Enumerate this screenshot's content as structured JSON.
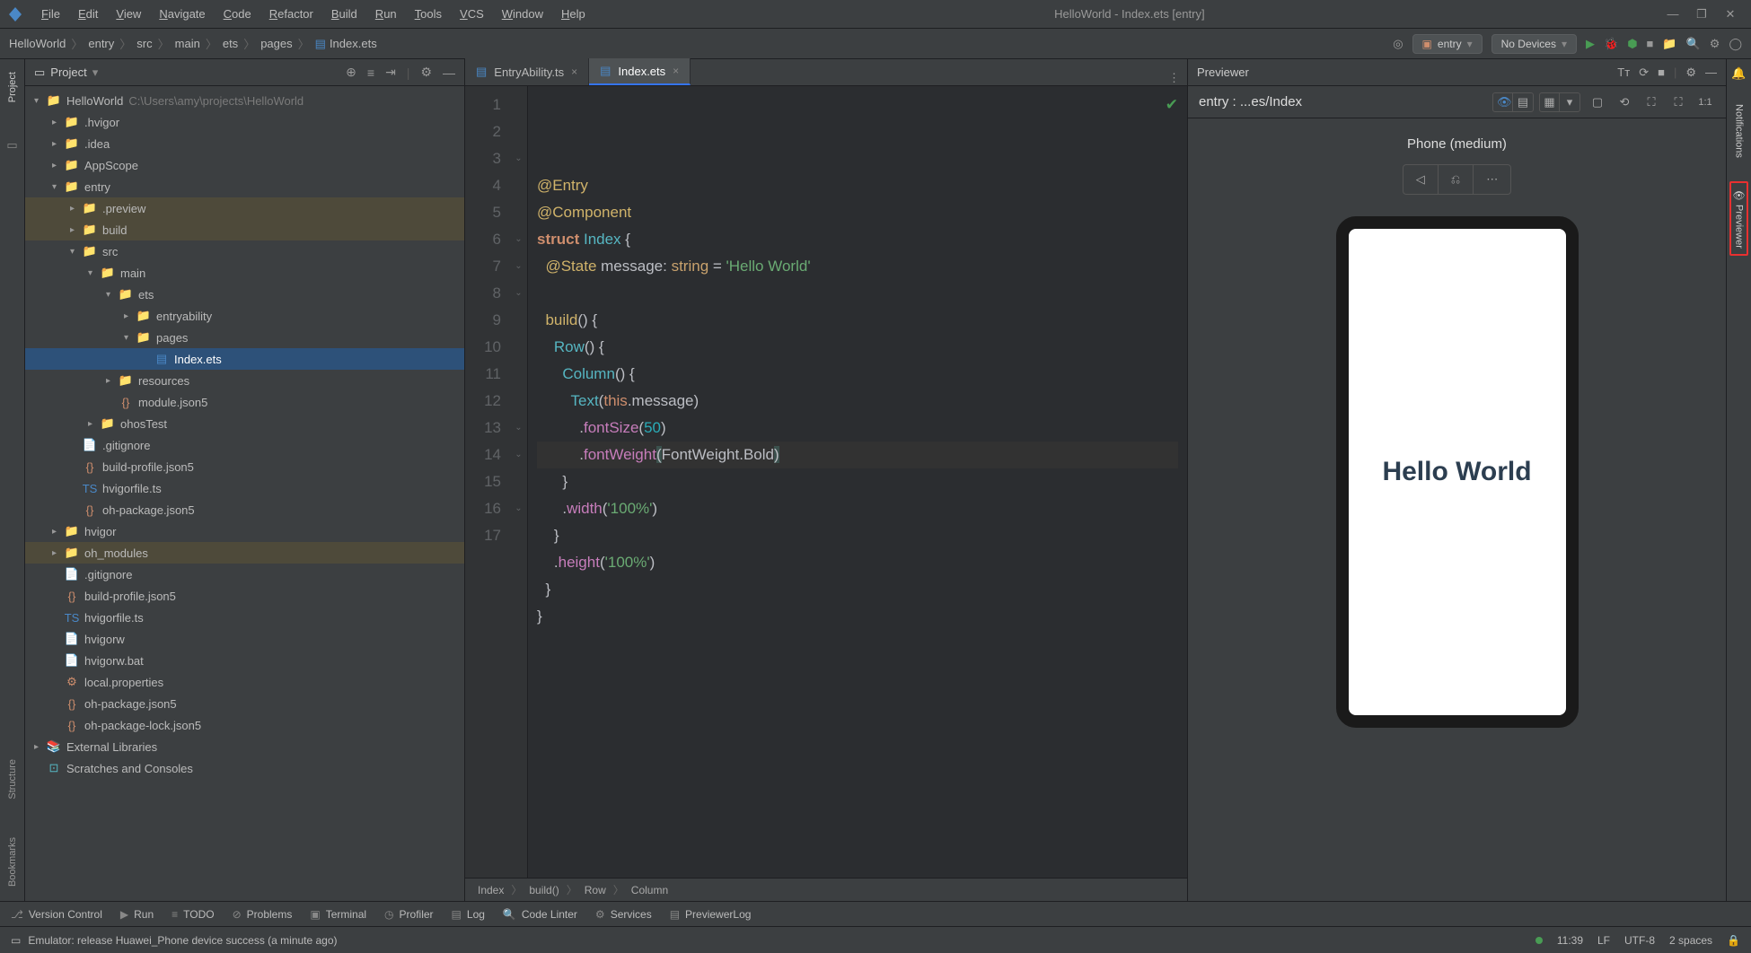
{
  "window_title": "HelloWorld - Index.ets [entry]",
  "menus": [
    "File",
    "Edit",
    "View",
    "Navigate",
    "Code",
    "Refactor",
    "Build",
    "Run",
    "Tools",
    "VCS",
    "Window",
    "Help"
  ],
  "breadcrumb": {
    "items": [
      "HelloWorld",
      "entry",
      "src",
      "main",
      "ets",
      "pages",
      "Index.ets"
    ]
  },
  "run_config": {
    "module": "entry",
    "device": "No Devices"
  },
  "project": {
    "panel_label": "Project",
    "root": {
      "name": "HelloWorld",
      "path": "C:\\Users\\amy\\projects\\HelloWorld"
    },
    "tree": [
      {
        "depth": 0,
        "arrow": "v",
        "icon": "folder-teal",
        "label": "HelloWorld",
        "extra": "C:\\Users\\amy\\projects\\HelloWorld"
      },
      {
        "depth": 1,
        "arrow": ">",
        "icon": "folder-gray",
        "label": ".hvigor"
      },
      {
        "depth": 1,
        "arrow": ">",
        "icon": "folder-gray",
        "label": ".idea"
      },
      {
        "depth": 1,
        "arrow": ">",
        "icon": "folder-gray",
        "label": "AppScope"
      },
      {
        "depth": 1,
        "arrow": "v",
        "icon": "folder-teal",
        "label": "entry"
      },
      {
        "depth": 2,
        "arrow": ">",
        "icon": "folder-orange",
        "label": ".preview",
        "hl": true
      },
      {
        "depth": 2,
        "arrow": ">",
        "icon": "folder-orange",
        "label": "build",
        "hl": true
      },
      {
        "depth": 2,
        "arrow": "v",
        "icon": "folder-gray",
        "label": "src"
      },
      {
        "depth": 3,
        "arrow": "v",
        "icon": "folder-gray",
        "label": "main"
      },
      {
        "depth": 4,
        "arrow": "v",
        "icon": "folder-gray",
        "label": "ets"
      },
      {
        "depth": 5,
        "arrow": ">",
        "icon": "folder-gray",
        "label": "entryability"
      },
      {
        "depth": 5,
        "arrow": "v",
        "icon": "folder-gray",
        "label": "pages"
      },
      {
        "depth": 6,
        "arrow": "",
        "icon": "file-ets",
        "label": "Index.ets",
        "sel": true
      },
      {
        "depth": 4,
        "arrow": ">",
        "icon": "folder-gray",
        "label": "resources"
      },
      {
        "depth": 4,
        "arrow": "",
        "icon": "file-json",
        "label": "module.json5"
      },
      {
        "depth": 3,
        "arrow": ">",
        "icon": "folder-gray",
        "label": "ohosTest"
      },
      {
        "depth": 2,
        "arrow": "",
        "icon": "file",
        "label": ".gitignore"
      },
      {
        "depth": 2,
        "arrow": "",
        "icon": "file-json",
        "label": "build-profile.json5"
      },
      {
        "depth": 2,
        "arrow": "",
        "icon": "file-ts",
        "label": "hvigorfile.ts"
      },
      {
        "depth": 2,
        "arrow": "",
        "icon": "file-json",
        "label": "oh-package.json5"
      },
      {
        "depth": 1,
        "arrow": ">",
        "icon": "folder-gray",
        "label": "hvigor"
      },
      {
        "depth": 1,
        "arrow": ">",
        "icon": "folder-orange",
        "label": "oh_modules",
        "hl": true
      },
      {
        "depth": 1,
        "arrow": "",
        "icon": "file",
        "label": ".gitignore"
      },
      {
        "depth": 1,
        "arrow": "",
        "icon": "file-json",
        "label": "build-profile.json5"
      },
      {
        "depth": 1,
        "arrow": "",
        "icon": "file-ts",
        "label": "hvigorfile.ts"
      },
      {
        "depth": 1,
        "arrow": "",
        "icon": "file",
        "label": "hvigorw"
      },
      {
        "depth": 1,
        "arrow": "",
        "icon": "file",
        "label": "hvigorw.bat"
      },
      {
        "depth": 1,
        "arrow": "",
        "icon": "file-prop",
        "label": "local.properties"
      },
      {
        "depth": 1,
        "arrow": "",
        "icon": "file-json",
        "label": "oh-package.json5"
      },
      {
        "depth": 1,
        "arrow": "",
        "icon": "file-json",
        "label": "oh-package-lock.json5"
      },
      {
        "depth": 0,
        "arrow": ">",
        "icon": "lib",
        "label": "External Libraries"
      },
      {
        "depth": 0,
        "arrow": "",
        "icon": "scratch",
        "label": "Scratches and Consoles"
      }
    ]
  },
  "editor": {
    "tabs": [
      {
        "label": "EntryAbility.ts",
        "active": false
      },
      {
        "label": "Index.ets",
        "active": true
      }
    ],
    "code_breadcrumb": [
      "Index",
      "build()",
      "Row",
      "Column"
    ],
    "lines_count": 17
  },
  "previewer": {
    "title": "Previewer",
    "entry": "entry : ...es/Index",
    "device_label": "Phone (medium)",
    "preview_text": "Hello World"
  },
  "tool_strip": [
    {
      "icon": "vcs",
      "label": "Version Control"
    },
    {
      "icon": "run",
      "label": "Run"
    },
    {
      "icon": "todo",
      "label": "TODO"
    },
    {
      "icon": "problems",
      "label": "Problems"
    },
    {
      "icon": "terminal",
      "label": "Terminal"
    },
    {
      "icon": "profiler",
      "label": "Profiler"
    },
    {
      "icon": "log",
      "label": "Log"
    },
    {
      "icon": "linter",
      "label": "Code Linter"
    },
    {
      "icon": "services",
      "label": "Services"
    },
    {
      "icon": "previewlog",
      "label": "PreviewerLog"
    }
  ],
  "status": {
    "message": "Emulator: release Huawei_Phone device success (a minute ago)",
    "pos": "11:39",
    "linesep": "LF",
    "encoding": "UTF-8",
    "indent": "2 spaces"
  },
  "left_rail": [
    "Project",
    "Structure",
    "Bookmarks"
  ],
  "right_rail": [
    "Notifications",
    "Previewer"
  ]
}
